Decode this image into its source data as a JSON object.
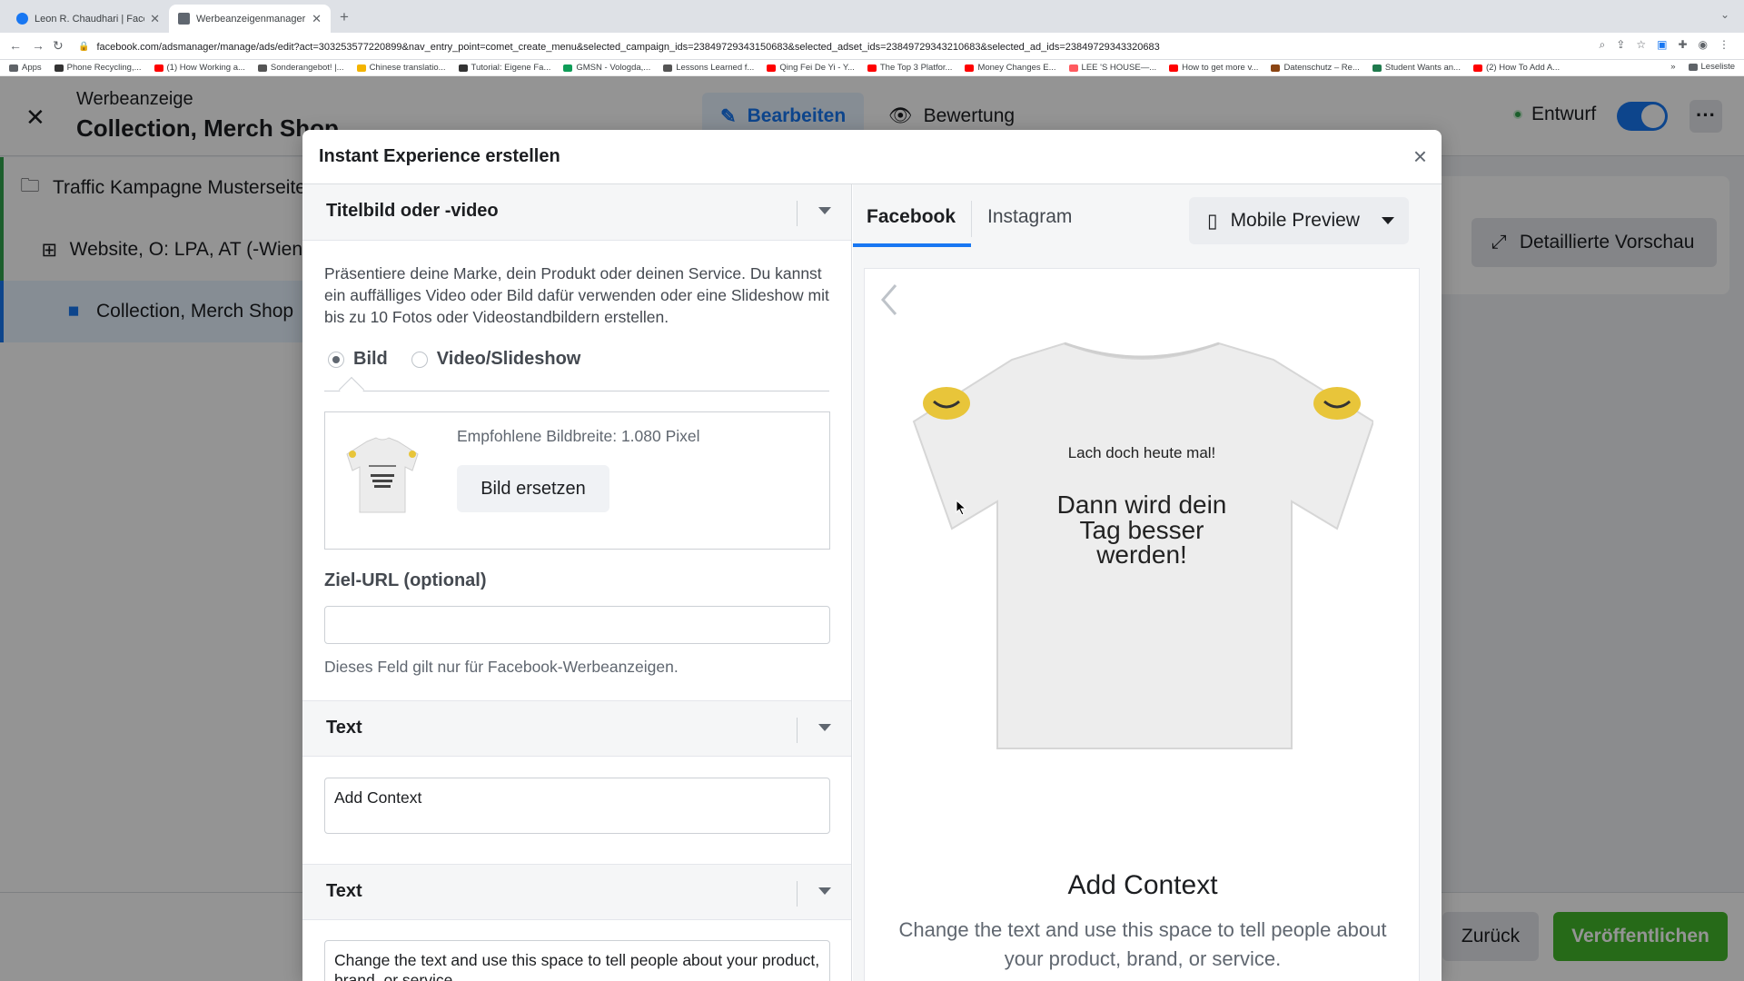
{
  "browser": {
    "tabs": [
      {
        "title": "Leon R. Chaudhari | Facebook",
        "icon": "facebook-favicon",
        "color": "#1877f2"
      },
      {
        "title": "Werbeanzeigenmanager - Wer",
        "icon": "adsmanager-favicon",
        "color": "#606770"
      }
    ],
    "url": "facebook.com/adsmanager/manage/ads/edit?act=303253577220899&nav_entry_point=comet_create_menu&selected_campaign_ids=23849729343150683&selected_adset_ids=23849729343210683&selected_ad_ids=23849729343320683",
    "bookmarks": [
      {
        "label": "Apps",
        "color": "#5f6368"
      },
      {
        "label": "Phone Recycling,...",
        "color": "#333333"
      },
      {
        "label": "(1) How Working a...",
        "color": "#ff0000"
      },
      {
        "label": "Sonderangebot! |...",
        "color": "#555555"
      },
      {
        "label": "Chinese translatio...",
        "color": "#f4b400"
      },
      {
        "label": "Tutorial: Eigene Fa...",
        "color": "#333333"
      },
      {
        "label": "GMSN - Vologda,...",
        "color": "#0f9d58"
      },
      {
        "label": "Lessons Learned f...",
        "color": "#555555"
      },
      {
        "label": "Qing Fei De Yi - Y...",
        "color": "#ff0000"
      },
      {
        "label": "The Top 3 Platfor...",
        "color": "#ff0000"
      },
      {
        "label": "Money Changes E...",
        "color": "#ff0000"
      },
      {
        "label": "LEE 'S HOUSE—...",
        "color": "#ff5a5f"
      },
      {
        "label": "How to get more v...",
        "color": "#ff0000"
      },
      {
        "label": "Datenschutz – Re...",
        "color": "#8b4513"
      },
      {
        "label": "Student Wants an...",
        "color": "#1f7a4d"
      },
      {
        "label": "(2) How To Add A...",
        "color": "#ff0000"
      }
    ],
    "reading_list": "Leseliste"
  },
  "app": {
    "header_small": "Werbeanzeige",
    "header_big": "Collection, Merch Shop",
    "tab_edit": "Bearbeiten",
    "tab_review": "Bewertung",
    "status": "Entwurf",
    "status_color": "#31a24c",
    "accent": "#1877f2",
    "nav_items": [
      {
        "label": "Traffic Kampagne Musterseite",
        "icon": "folder-icon"
      },
      {
        "label": "Website, O: LPA, AT (-Wien)",
        "icon": "grid-icon"
      },
      {
        "label": "Collection, Merch Shop",
        "icon": "ad-square-icon"
      }
    ],
    "detail_preview": "Detaillierte Vorschau",
    "back_button": "Zurück",
    "publish_button": "Veröffentlichen",
    "publish_color": "#42b72a"
  },
  "modal": {
    "title": "Instant Experience erstellen",
    "section_cover": {
      "title": "Titelbild oder -video",
      "description": "Präsentiere deine Marke, dein Produkt oder deinen Service. Du kannst ein auffälliges Video oder Bild dafür verwenden oder eine Slideshow mit bis zu 10 Fotos oder Videostandbildern erstellen.",
      "radio_image": "Bild",
      "radio_video": "Video/Slideshow",
      "selected": "Bild",
      "recommended_width": "Empfohlene Bildbreite: 1.080 Pixel",
      "replace_button": "Bild ersetzen",
      "url_label": "Ziel-URL (optional)",
      "url_value": "",
      "url_hint": "Dieses Feld gilt nur für Facebook-Werbeanzeigen."
    },
    "section_text1": {
      "title": "Text",
      "value": "Add Context"
    },
    "section_text2": {
      "title": "Text",
      "value": "Change the text and use this space to tell people about your product, brand, or service."
    },
    "preview": {
      "tab_facebook": "Facebook",
      "tab_instagram": "Instagram",
      "device": "Mobile Preview",
      "shirt_small": "Lach doch heute mal!",
      "shirt_big_1": "Dann wird dein",
      "shirt_big_2": "Tag besser",
      "shirt_big_3": "werden!",
      "heading": "Add Context",
      "body": "Change the text and use this space to tell people about your product, brand, or service."
    }
  }
}
